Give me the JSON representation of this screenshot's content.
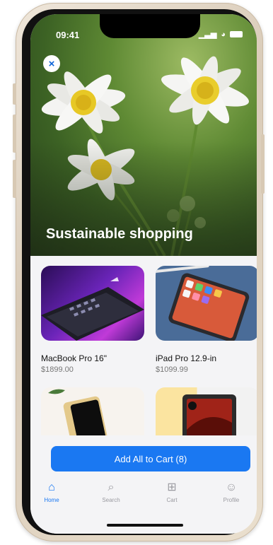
{
  "status_bar": {
    "time": "09:41",
    "signal": "▁▃▅",
    "wifi": "◕"
  },
  "hero": {
    "title": "Sustainable shopping",
    "close_glyph": "×"
  },
  "products": [
    {
      "name": "MacBook Pro 16\"",
      "price": "$1899.00"
    },
    {
      "name": "iPad Pro 12.9-in",
      "price": "$1099.99"
    },
    {
      "name": "",
      "price": ""
    },
    {
      "name": "",
      "price": ""
    }
  ],
  "cta": {
    "label": "Add All to Cart (8)"
  },
  "tabbar": {
    "items": [
      {
        "label": "Home",
        "icon": "⌂"
      },
      {
        "label": "Search",
        "icon": "⌕"
      },
      {
        "label": "Cart",
        "icon": "⊞"
      },
      {
        "label": "Profile",
        "icon": "☺"
      }
    ]
  },
  "colors": {
    "accent": "#1a78f2",
    "tab_inactive": "#9a9aa0",
    "background": "#f4f4f6"
  }
}
